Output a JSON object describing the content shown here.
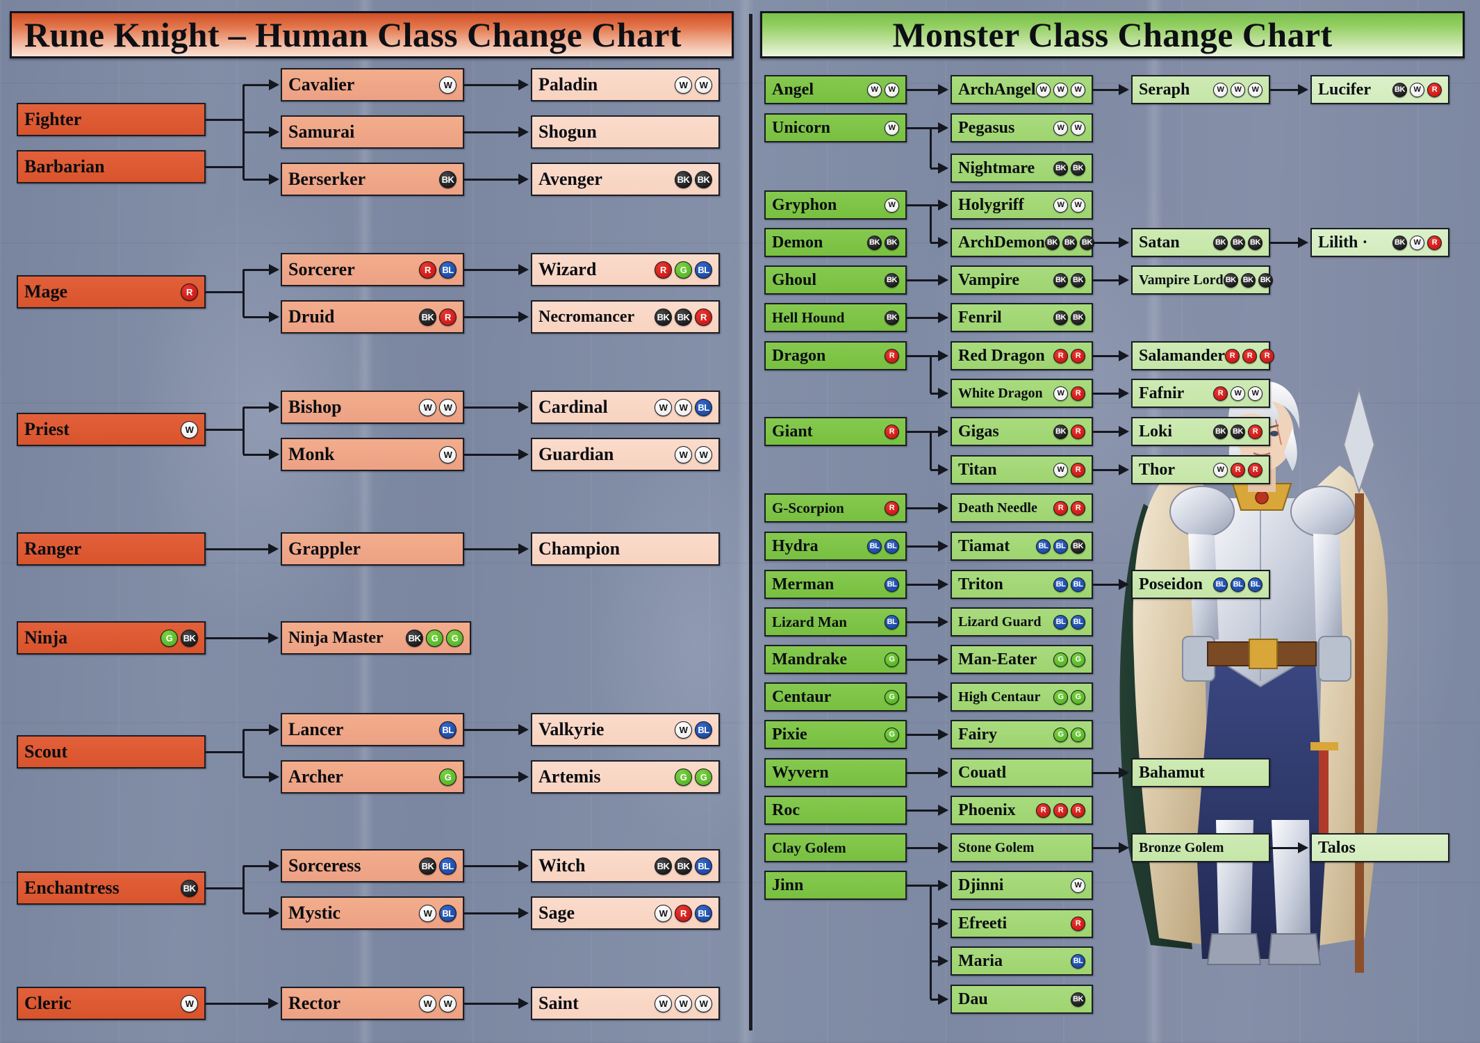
{
  "page": {
    "background_color": "#7e8aa4"
  },
  "panels": {
    "human": {
      "title": "Rune Knight – Human Class Change Chart",
      "title_gradient_from": "#d24f27",
      "title_gradient_to": "#fae3d6",
      "tier_colors": {
        "tier1": "#d9542c",
        "tier2": "#eda184",
        "tier3": "#f8d3c0"
      },
      "groups": [
        {
          "name": "fighter-group",
          "tier1": [
            {
              "label": "Fighter",
              "badges": []
            },
            {
              "label": "Barbarian",
              "badges": []
            }
          ],
          "tier2": [
            {
              "label": "Cavalier",
              "badges": [
                "W"
              ]
            },
            {
              "label": "Samurai",
              "badges": []
            },
            {
              "label": "Berserker",
              "badges": [
                "BK"
              ]
            }
          ],
          "tier3": [
            {
              "label": "Paladin",
              "badges": [
                "W",
                "W"
              ]
            },
            {
              "label": "Shogun",
              "badges": []
            },
            {
              "label": "Avenger",
              "badges": [
                "BK",
                "BK"
              ]
            }
          ]
        },
        {
          "name": "mage-group",
          "tier1": [
            {
              "label": "Mage",
              "badges": [
                "R"
              ]
            }
          ],
          "tier2": [
            {
              "label": "Sorcerer",
              "badges": [
                "R",
                "BL"
              ]
            },
            {
              "label": "Druid",
              "badges": [
                "BK",
                "R"
              ]
            }
          ],
          "tier3": [
            {
              "label": "Wizard",
              "badges": [
                "R",
                "G",
                "BL"
              ]
            },
            {
              "label": "Necromancer",
              "badges": [
                "BK",
                "BK",
                "R"
              ]
            }
          ]
        },
        {
          "name": "priest-group",
          "tier1": [
            {
              "label": "Priest",
              "badges": [
                "W"
              ]
            }
          ],
          "tier2": [
            {
              "label": "Bishop",
              "badges": [
                "W",
                "W"
              ]
            },
            {
              "label": "Monk",
              "badges": [
                "W"
              ]
            }
          ],
          "tier3": [
            {
              "label": "Cardinal",
              "badges": [
                "W",
                "W",
                "BL"
              ]
            },
            {
              "label": "Guardian",
              "badges": [
                "W",
                "W"
              ]
            }
          ]
        },
        {
          "name": "ranger-group",
          "tier1": [
            {
              "label": "Ranger",
              "badges": []
            }
          ],
          "tier2": [
            {
              "label": "Grappler",
              "badges": []
            }
          ],
          "tier3": [
            {
              "label": "Champion",
              "badges": []
            }
          ]
        },
        {
          "name": "ninja-group",
          "tier1": [
            {
              "label": "Ninja",
              "badges": [
                "G",
                "BK"
              ]
            }
          ],
          "tier2": [
            {
              "label": "Ninja Master",
              "badges": [
                "BK",
                "G",
                "G"
              ]
            }
          ],
          "tier3": []
        },
        {
          "name": "scout-group",
          "tier1": [
            {
              "label": "Scout",
              "badges": []
            }
          ],
          "tier2": [
            {
              "label": "Lancer",
              "badges": [
                "BL"
              ]
            },
            {
              "label": "Archer",
              "badges": [
                "G"
              ]
            }
          ],
          "tier3": [
            {
              "label": "Valkyrie",
              "badges": [
                "W",
                "BL"
              ]
            },
            {
              "label": "Artemis",
              "badges": [
                "G",
                "G"
              ]
            }
          ]
        },
        {
          "name": "enchantress-group",
          "tier1": [
            {
              "label": "Enchantress",
              "badges": [
                "BK"
              ]
            }
          ],
          "tier2": [
            {
              "label": "Sorceress",
              "badges": [
                "BK",
                "BL"
              ]
            },
            {
              "label": "Mystic",
              "badges": [
                "W",
                "BL"
              ]
            }
          ],
          "tier3": [
            {
              "label": "Witch",
              "badges": [
                "BK",
                "BK",
                "BL"
              ]
            },
            {
              "label": "Sage",
              "badges": [
                "W",
                "R",
                "BL"
              ]
            }
          ]
        },
        {
          "name": "cleric-group",
          "tier1": [
            {
              "label": "Cleric",
              "badges": [
                "W"
              ]
            }
          ],
          "tier2": [
            {
              "label": "Rector",
              "badges": [
                "W",
                "W"
              ]
            }
          ],
          "tier3": [
            {
              "label": "Saint",
              "badges": [
                "W",
                "W",
                "W"
              ]
            }
          ]
        }
      ]
    },
    "monster": {
      "title": "Monster Class Change Chart",
      "title_gradient_from": "#79c14a",
      "title_gradient_to": "#eaf6dd",
      "tier_colors": {
        "tier1": "#78c040",
        "tier2": "#9ed470",
        "tier3": "#c5e6a8",
        "tier4": "#d3ecbd"
      },
      "rows": [
        {
          "name": "angel",
          "tier1": {
            "label": "Angel",
            "badges": [
              "W",
              "W"
            ]
          },
          "tier2": {
            "label": "ArchAngel",
            "badges": [
              "W",
              "W",
              "W"
            ]
          },
          "tier3": {
            "label": "Seraph",
            "badges": [
              "W",
              "W",
              "W"
            ]
          },
          "tier4": {
            "label": "Lucifer",
            "badges": [
              "BK",
              "W",
              "R"
            ]
          }
        },
        {
          "name": "unicorn",
          "tier1": {
            "label": "Unicorn",
            "badges": [
              "W"
            ]
          },
          "tier2": {
            "label": "Pegasus",
            "badges": [
              "W",
              "W"
            ]
          }
        },
        {
          "name": "nightmare",
          "tier2": {
            "label": "Nightmare",
            "badges": [
              "BK",
              "BK"
            ]
          }
        },
        {
          "name": "gryphon",
          "tier1": {
            "label": "Gryphon",
            "badges": [
              "W"
            ]
          },
          "tier2": {
            "label": "Holygriff",
            "badges": [
              "W",
              "W"
            ]
          }
        },
        {
          "name": "demon",
          "tier1": {
            "label": "Demon",
            "badges": [
              "BK",
              "BK"
            ]
          },
          "tier2": {
            "label": "ArchDemon",
            "badges": [
              "BK",
              "BK",
              "BK"
            ]
          },
          "tier3": {
            "label": "Satan",
            "badges": [
              "BK",
              "BK",
              "BK"
            ]
          },
          "tier4": {
            "label": "Lilith ·",
            "badges": [
              "BK",
              "W",
              "R"
            ]
          }
        },
        {
          "name": "ghoul",
          "tier1": {
            "label": "Ghoul",
            "badges": [
              "BK"
            ]
          },
          "tier2": {
            "label": "Vampire",
            "badges": [
              "BK",
              "BK"
            ]
          },
          "tier3": {
            "label": "Vampire Lord",
            "badges": [
              "BK",
              "BK",
              "BK"
            ]
          }
        },
        {
          "name": "hell-hound",
          "tier1": {
            "label": "Hell Hound",
            "badges": [
              "BK"
            ]
          },
          "tier2": {
            "label": "Fenril",
            "badges": [
              "BK",
              "BK"
            ]
          }
        },
        {
          "name": "dragon",
          "tier1": {
            "label": "Dragon",
            "badges": [
              "R"
            ]
          },
          "tier2": {
            "label": "Red Dragon",
            "badges": [
              "R",
              "R"
            ]
          },
          "tier3": {
            "label": "Salamander",
            "badges": [
              "R",
              "R",
              "R"
            ]
          }
        },
        {
          "name": "white-dragon",
          "tier2": {
            "label": "White Dragon",
            "badges": [
              "W",
              "R"
            ]
          },
          "tier3": {
            "label": "Fafnir",
            "badges": [
              "R",
              "W",
              "W"
            ]
          }
        },
        {
          "name": "giant",
          "tier1": {
            "label": "Giant",
            "badges": [
              "R"
            ]
          },
          "tier2": {
            "label": "Gigas",
            "badges": [
              "BK",
              "R"
            ]
          },
          "tier3": {
            "label": "Loki",
            "badges": [
              "BK",
              "BK",
              "R"
            ]
          }
        },
        {
          "name": "titan",
          "tier2": {
            "label": "Titan",
            "badges": [
              "W",
              "R"
            ]
          },
          "tier3": {
            "label": "Thor",
            "badges": [
              "W",
              "R",
              "R"
            ]
          }
        },
        {
          "name": "g-scorpion",
          "tier1": {
            "label": "G-Scorpion",
            "badges": [
              "R"
            ]
          },
          "tier2": {
            "label": "Death Needle",
            "badges": [
              "R",
              "R"
            ]
          }
        },
        {
          "name": "hydra",
          "tier1": {
            "label": "Hydra",
            "badges": [
              "BL",
              "BL"
            ]
          },
          "tier2": {
            "label": "Tiamat",
            "badges": [
              "BL",
              "BL",
              "BK"
            ]
          }
        },
        {
          "name": "merman",
          "tier1": {
            "label": "Merman",
            "badges": [
              "BL"
            ]
          },
          "tier2": {
            "label": "Triton",
            "badges": [
              "BL",
              "BL"
            ]
          },
          "tier3": {
            "label": "Poseidon",
            "badges": [
              "BL",
              "BL",
              "BL"
            ]
          }
        },
        {
          "name": "lizard-man",
          "tier1": {
            "label": "Lizard Man",
            "badges": [
              "BL"
            ]
          },
          "tier2": {
            "label": "Lizard Guard",
            "badges": [
              "BL",
              "BL"
            ]
          }
        },
        {
          "name": "mandrake",
          "tier1": {
            "label": "Mandrake",
            "badges": [
              "G"
            ]
          },
          "tier2": {
            "label": "Man-Eater",
            "badges": [
              "G",
              "G"
            ]
          }
        },
        {
          "name": "centaur",
          "tier1": {
            "label": "Centaur",
            "badges": [
              "G"
            ]
          },
          "tier2": {
            "label": "High Centaur",
            "badges": [
              "G",
              "G"
            ]
          }
        },
        {
          "name": "pixie",
          "tier1": {
            "label": "Pixie",
            "badges": [
              "G"
            ]
          },
          "tier2": {
            "label": "Fairy",
            "badges": [
              "G",
              "G"
            ]
          }
        },
        {
          "name": "wyvern",
          "tier1": {
            "label": "Wyvern",
            "badges": []
          },
          "tier2": {
            "label": "Couatl",
            "badges": []
          },
          "tier3": {
            "label": "Bahamut",
            "badges": []
          }
        },
        {
          "name": "roc",
          "tier1": {
            "label": "Roc",
            "badges": []
          },
          "tier2": {
            "label": "Phoenix",
            "badges": [
              "R",
              "R",
              "R"
            ]
          }
        },
        {
          "name": "clay-golem",
          "tier1": {
            "label": "Clay Golem",
            "badges": []
          },
          "tier2": {
            "label": "Stone Golem",
            "badges": []
          },
          "tier3": {
            "label": "Bronze Golem",
            "badges": []
          },
          "tier4": {
            "label": "Talos",
            "badges": []
          }
        },
        {
          "name": "jinn",
          "tier1": {
            "label": "Jinn",
            "badges": []
          },
          "tier2": {
            "label": "Djinni",
            "badges": [
              "W"
            ]
          }
        },
        {
          "name": "efreeti",
          "tier2": {
            "label": "Efreeti",
            "badges": [
              "R"
            ]
          }
        },
        {
          "name": "maria",
          "tier2": {
            "label": "Maria",
            "badges": [
              "BL"
            ]
          }
        },
        {
          "name": "dau",
          "tier2": {
            "label": "Dau",
            "badges": [
              "BK"
            ]
          }
        }
      ]
    }
  },
  "legend": {
    "badge_names": {
      "W": "W",
      "BK": "BK",
      "R": "R",
      "G": "G",
      "BL": "BL"
    },
    "badge_colors": {
      "W": "#ffffff",
      "BK": "#0a0a0a",
      "R": "#c20f10",
      "G": "#4fae22",
      "BL": "#12409b"
    }
  }
}
